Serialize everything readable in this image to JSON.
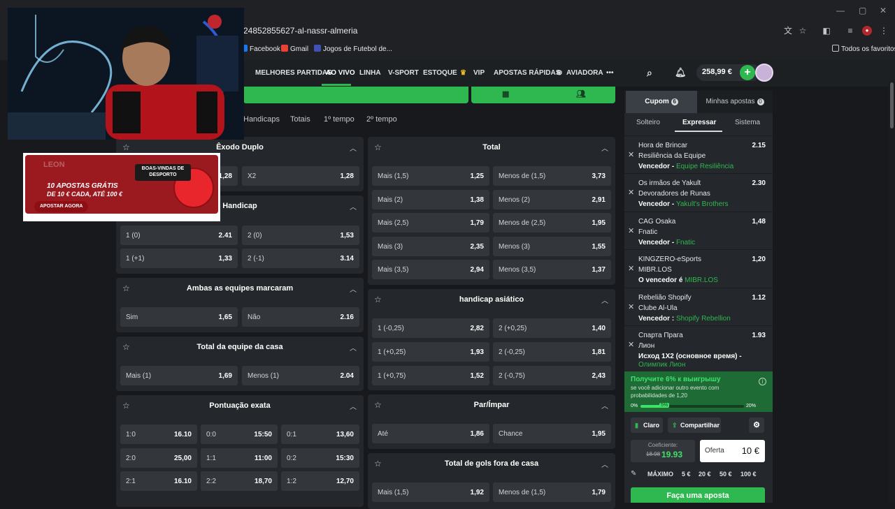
{
  "browser": {
    "url": "24852855627-al-nassr-almeria",
    "bookmarks": [
      "Facebook",
      "Gmail",
      "Jogos de Futebol de...",
      "Todos os favoritos"
    ]
  },
  "nav": {
    "items": [
      "MELHORES PARTIDAS",
      "AO VIVO",
      "LINHA",
      "V-SPORT",
      "ESTOQUE",
      "VIP",
      "APOSTAS RÁPIDAS",
      "AVIADORA"
    ],
    "more": "•••",
    "balance": "258,99 €",
    "plus": "+"
  },
  "subtabs": [
    "Handicaps",
    "Totais",
    "1º tempo",
    "2º tempo"
  ],
  "ad": {
    "heading": "BOAS-VINDAS DE DESPORTO",
    "line1": "10 APOSTAS GRÁTIS",
    "line2": "DE 10 € CADA, ATÉ 100 €",
    "cta": "APOSTAR AGORA",
    "logo": "LEON"
  },
  "markets": {
    "exodo": {
      "title": "Êxodo Duplo",
      "cells": [
        [
          "",
          "1,28"
        ],
        [
          "X2",
          "1,28"
        ]
      ]
    },
    "handicap": {
      "title": "Handicap",
      "cells": [
        [
          "1 (0)",
          "2.41"
        ],
        [
          "2 (0)",
          "1,53"
        ],
        [
          "1 (+1)",
          "1,33"
        ],
        [
          "2 (-1)",
          "3.14"
        ]
      ]
    },
    "ambas": {
      "title": "Ambas as equipes marcaram",
      "cells": [
        [
          "Sim",
          "1,65"
        ],
        [
          "Não",
          "2.16"
        ]
      ]
    },
    "totalcasa": {
      "title": "Total da equipe da casa",
      "cells": [
        [
          "Mais (1)",
          "1,69"
        ],
        [
          "Menos (1)",
          "2.04"
        ]
      ]
    },
    "exata": {
      "title": "Pontuação exata",
      "cells": [
        [
          "1:0",
          "16.10"
        ],
        [
          "0:0",
          "15:50"
        ],
        [
          "0:1",
          "13,60"
        ],
        [
          "2:0",
          "25,00"
        ],
        [
          "1:1",
          "11:00"
        ],
        [
          "0:2",
          "15:30"
        ],
        [
          "2:1",
          "16.10"
        ],
        [
          "2:2",
          "18,70"
        ],
        [
          "1:2",
          "12,70"
        ]
      ]
    },
    "total": {
      "title": "Total",
      "cells": [
        [
          "Mais (1,5)",
          "1,25"
        ],
        [
          "Menos de (1,5)",
          "3,73"
        ],
        [
          "Mais (2)",
          "1,38"
        ],
        [
          "Menos (2)",
          "2,91"
        ],
        [
          "Mais (2,5)",
          "1,79"
        ],
        [
          "Menos de (2,5)",
          "1,95"
        ],
        [
          "Mais (3)",
          "2,35"
        ],
        [
          "Menos (3)",
          "1,55"
        ],
        [
          "Mais (3,5)",
          "2,94"
        ],
        [
          "Menos (3,5)",
          "1,37"
        ]
      ]
    },
    "asiatico": {
      "title": "handicap asiático",
      "cells": [
        [
          "1 (-0,25)",
          "2,82"
        ],
        [
          "2 (+0,25)",
          "1,40"
        ],
        [
          "1 (+0,25)",
          "1,93"
        ],
        [
          "2 (-0,25)",
          "1,81"
        ],
        [
          "1 (+0,75)",
          "1,52"
        ],
        [
          "2 (-0,75)",
          "2,43"
        ]
      ]
    },
    "parimpar": {
      "title": "Par/Ímpar",
      "cells": [
        [
          "Até",
          "1,86"
        ],
        [
          "Chance",
          "1,95"
        ]
      ]
    },
    "golsfora": {
      "title": "Total de gols fora de casa",
      "cells": [
        [
          "Mais (1,5)",
          "1,92"
        ],
        [
          "Menos de (1,5)",
          "1,79"
        ]
      ]
    }
  },
  "betslip": {
    "tabs": [
      {
        "label": "Cupom",
        "badge": "6"
      },
      {
        "label": "Minhas apostas",
        "badge": "0"
      }
    ],
    "types": [
      "Solteiro",
      "Expressar",
      "Sistema"
    ],
    "selections": [
      {
        "t1": "Hora de Brincar",
        "t2": "Resiliência da Equipe",
        "pre": "Vencedor",
        "sep": "-",
        "pick": "Equipe Resiliência",
        "odd": "2.15"
      },
      {
        "t1": "Os irmãos de Yakult",
        "t2": "Devoradores de Runas",
        "pre": "Vencedor",
        "sep": "-",
        "pick": "Yakult's Brothers",
        "odd": "2.30"
      },
      {
        "t1": "CAG Osaka",
        "t2": "Fnatic",
        "pre": "Vencedor",
        "sep": "-",
        "pick": "Fnatic",
        "odd": "1,48"
      },
      {
        "t1": "KINGZERO-eSports",
        "t2": "MIBR.LOS",
        "pre": "O vencedor",
        "sep": "é",
        "pick": "MIBR.LOS",
        "odd": "1,20"
      },
      {
        "t1": "Rebelião Shopify",
        "t2": "Clube Al-Ula",
        "pre": "Vencedor",
        "sep": ":",
        "pick": "Shopify Rebellion",
        "odd": "1.12"
      },
      {
        "t1": "Спарта Прага",
        "t2": "Лион",
        "pre": "Исход 1X2 (основное время)",
        "sep": "-",
        "pick": "Олимпик Лион",
        "odd": "1.93"
      }
    ],
    "promo": {
      "title": "Получите 6% к выигрышу",
      "text1": "se você adicionar outro evento com",
      "text2": "probabilidades de 1,20",
      "from": "0%",
      "current": "5%",
      "to": "20%",
      "progress": 0.25
    },
    "claro": "Claro",
    "share": "Compartilhar",
    "coef_label": "Coeficiente:",
    "coef_old": "18.98",
    "coef_new": "19.93",
    "stake_label": "Oferta",
    "stake_value": "10 €",
    "max_label": "MÁXIMO",
    "quick": [
      "5 €",
      "20 €",
      "50 €",
      "100 €"
    ],
    "place": "Faça uma aposta"
  }
}
